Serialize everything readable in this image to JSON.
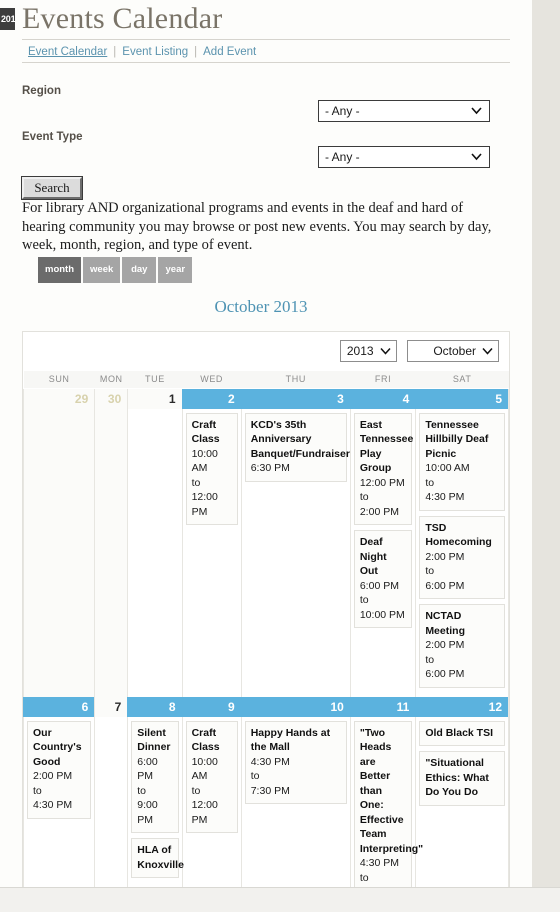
{
  "left_stub": {
    "text": "201"
  },
  "header": {
    "title": "Events Calendar",
    "tabs": [
      {
        "label": "Event Calendar",
        "active": true
      },
      {
        "label": "Event Listing",
        "active": false
      },
      {
        "label": "Add Event",
        "active": false
      }
    ],
    "tab_separator": "|"
  },
  "filters": {
    "region": {
      "label": "Region",
      "value": "- Any -"
    },
    "event_type": {
      "label": "Event Type",
      "value": "- Any -"
    },
    "search_button": "Search"
  },
  "blurb": "For library AND organizational programs and events in the deaf and hard of hearing community you may browse or post new events. You may search by day, week, month, region, and type of event.",
  "view_tabs": [
    {
      "label": "month",
      "selected": true
    },
    {
      "label": "week",
      "selected": false
    },
    {
      "label": "day",
      "selected": false
    },
    {
      "label": "year",
      "selected": false
    }
  ],
  "calendar": {
    "title": "October 2013",
    "year_select": {
      "value": "2013"
    },
    "month_select": {
      "value": "October"
    },
    "weekday_headers": [
      "SUN",
      "MON",
      "TUE",
      "WED",
      "THU",
      "FRI",
      "SAT"
    ],
    "weeks": [
      {
        "days": [
          {
            "num": "29",
            "state": "past",
            "colspan": 1
          },
          {
            "num": "30",
            "state": "past",
            "colspan": 1
          },
          {
            "num": "1",
            "state": "today-plain",
            "colspan": 1
          },
          {
            "num": "2",
            "state": "hl",
            "colspan": 1
          },
          {
            "num": "3",
            "state": "hl",
            "colspan": 1
          },
          {
            "num": "4",
            "state": "hl",
            "colspan": 1
          },
          {
            "num": "5",
            "state": "hl",
            "colspan": 1
          }
        ],
        "cells": [
          {
            "empty": true,
            "past": true,
            "events": []
          },
          {
            "empty": true,
            "past": true,
            "events": []
          },
          {
            "empty": true,
            "past": false,
            "events": []
          },
          {
            "empty": false,
            "past": false,
            "events": [
              {
                "title": "Craft Class",
                "time": "10:00 AM\nto\n12:00 PM"
              }
            ]
          },
          {
            "empty": false,
            "past": false,
            "events": [
              {
                "title": "KCD's 35th Anniversary Banquet/Fundraiser",
                "time": "6:30 PM"
              }
            ]
          },
          {
            "empty": false,
            "past": false,
            "events": [
              {
                "title": "East Tennessee Play Group",
                "time": "12:00 PM\nto\n2:00 PM"
              },
              {
                "title": "Deaf Night Out",
                "time": "6:00 PM\nto\n10:00 PM"
              }
            ]
          },
          {
            "empty": false,
            "past": false,
            "events": [
              {
                "title": "Tennessee Hillbilly Deaf Picnic",
                "time": "10:00 AM\nto\n4:30 PM"
              },
              {
                "title": "TSD Homecoming",
                "time": "2:00 PM\nto\n6:00 PM"
              },
              {
                "title": "NCTAD Meeting",
                "time": "2:00 PM\nto\n6:00 PM"
              }
            ]
          }
        ]
      },
      {
        "days": [
          {
            "num": "6",
            "state": "hl",
            "colspan": 1
          },
          {
            "num": "7",
            "state": "today-plain",
            "colspan": 1
          },
          {
            "num": "8",
            "state": "hl",
            "colspan": 1
          },
          {
            "num": "9",
            "state": "hl",
            "colspan": 1
          },
          {
            "num": "10",
            "state": "hl",
            "colspan": 1
          },
          {
            "num": "11",
            "state": "hl",
            "colspan": 1
          },
          {
            "num": "12",
            "state": "hl",
            "colspan": 1
          }
        ],
        "cells": [
          {
            "empty": false,
            "past": false,
            "events": [
              {
                "title": "Our Country's Good",
                "time": "2:00 PM\nto\n4:30 PM"
              }
            ]
          },
          {
            "empty": true,
            "past": false,
            "events": []
          },
          {
            "empty": false,
            "past": false,
            "events": [
              {
                "title": "Silent Dinner",
                "time": "6:00 PM\nto\n9:00 PM"
              },
              {
                "title": "HLA of Knoxville",
                "time": ""
              }
            ]
          },
          {
            "empty": false,
            "past": false,
            "events": [
              {
                "title": "Craft Class",
                "time": "10:00 AM\nto\n12:00 PM"
              }
            ]
          },
          {
            "empty": false,
            "past": false,
            "events": [
              {
                "title": "Happy Hands at the Mall",
                "time": "4:30 PM\nto\n7:30 PM"
              }
            ]
          },
          {
            "empty": false,
            "past": false,
            "events": [
              {
                "title": "\"Two Heads are Better than One: Effective Team Interpreting\"",
                "time": "4:30 PM\nto"
              }
            ]
          },
          {
            "empty": false,
            "past": false,
            "events": [
              {
                "title": "Old Black TSI",
                "time": ""
              },
              {
                "title": "\"Situational Ethics: What Do You Do",
                "time": ""
              }
            ]
          }
        ]
      }
    ]
  },
  "colors": {
    "accent_blue": "#5bb2de",
    "link_blue": "#5b93ae",
    "title_gray": "#7a7468",
    "tab_gray": "#a5a5a5",
    "tab_gray_selected": "#6b6b6b"
  }
}
